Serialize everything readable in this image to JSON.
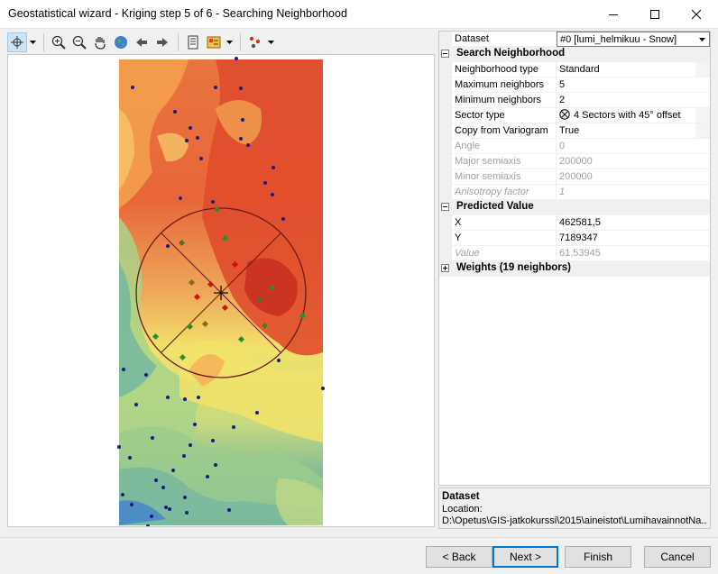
{
  "window": {
    "title": "Geostatistical wizard - Kriging step 5 of 6 - Searching Neighborhood"
  },
  "toolbar": {
    "tools": [
      "select-tool-icon",
      "zoom-in-icon",
      "zoom-out-icon",
      "pan-hand-icon",
      "full-extent-globe-icon",
      "back-arrow-icon",
      "forward-arrow-icon",
      "table-of-contents-icon",
      "legend-icon",
      "points-icon"
    ]
  },
  "dataset_row": {
    "label": "Dataset",
    "value": "#0 [lumi_helmikuu - Snow]"
  },
  "search_neighborhood": {
    "title": "Search Neighborhood",
    "rows": [
      {
        "label": "Neighborhood type",
        "value": "Standard"
      },
      {
        "label": "Maximum neighbors",
        "value": "5"
      },
      {
        "label": "Minimum neighbors",
        "value": "2"
      },
      {
        "label": "Sector type",
        "value": "4 Sectors with 45° offset"
      },
      {
        "label": "Copy from Variogram",
        "value": "True"
      },
      {
        "label": "Angle",
        "value": "0"
      },
      {
        "label": "Major semiaxis",
        "value": "200000"
      },
      {
        "label": "Minor semiaxis",
        "value": "200000"
      },
      {
        "label": "Anisotropy factor",
        "value": "1"
      }
    ]
  },
  "predicted_value": {
    "title": "Predicted Value",
    "rows": [
      {
        "label": "X",
        "value": "462581,5"
      },
      {
        "label": "Y",
        "value": "7189347"
      },
      {
        "label": "Value",
        "value": "61,53945"
      }
    ]
  },
  "weights": {
    "title": "Weights (19 neighbors)"
  },
  "description": {
    "title": "Dataset",
    "text": "Location:",
    "path": "D:\\Opetus\\GIS-jatkokurssi\\2015\\aineistot\\LumihavainnotNa..."
  },
  "buttons": {
    "back": "< Back",
    "next": "Next >",
    "finish": "Finish",
    "cancel": "Cancel"
  },
  "colors": {
    "accent": "#0078d7",
    "selected_bg": "#cce4f7"
  }
}
